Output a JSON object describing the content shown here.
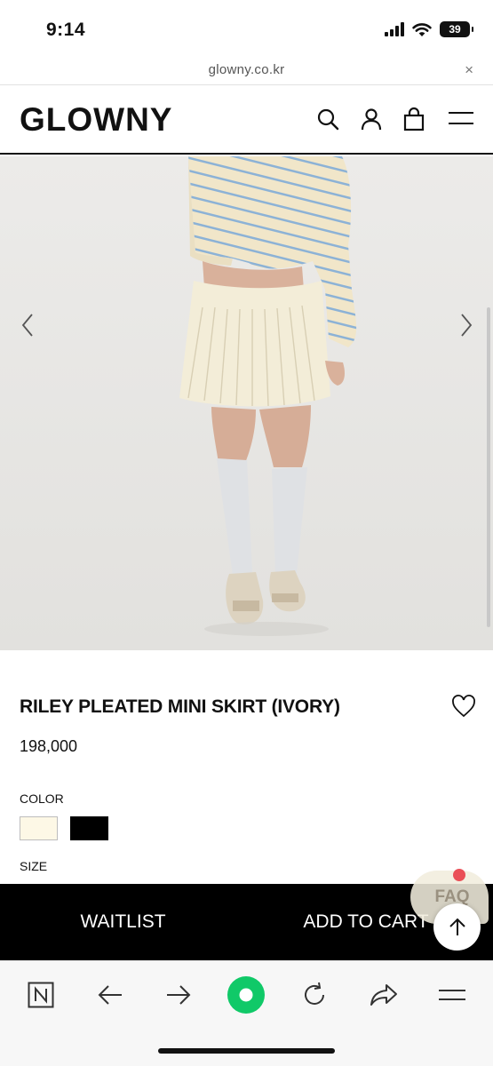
{
  "status_bar": {
    "time": "9:14",
    "battery": "39"
  },
  "browser": {
    "url": "glowny.co.kr",
    "close_glyph": "×"
  },
  "header": {
    "logo": "GLOWNY",
    "icons": [
      "search-icon",
      "account-icon",
      "bag-icon",
      "menu-icon"
    ]
  },
  "product": {
    "name": "RILEY PLEATED MINI SKIRT (IVORY)",
    "price": "198,000",
    "color_label": "COLOR",
    "size_label": "SIZE",
    "swatches": [
      {
        "name": "ivory",
        "color": "#fdf8e6"
      },
      {
        "name": "black",
        "color": "#000000"
      }
    ]
  },
  "actions": {
    "waitlist": "WAITLIST",
    "add_to_cart": "ADD TO CART"
  },
  "floating": {
    "faq": "FAQ",
    "faq_badge_color": "#ea4f57"
  },
  "toolbar": {
    "icons": [
      "naver-icon",
      "back-arrow-icon",
      "forward-arrow-icon",
      "green-home-icon",
      "refresh-icon",
      "share-icon",
      "menu-icon"
    ],
    "accent": "#10c968"
  }
}
